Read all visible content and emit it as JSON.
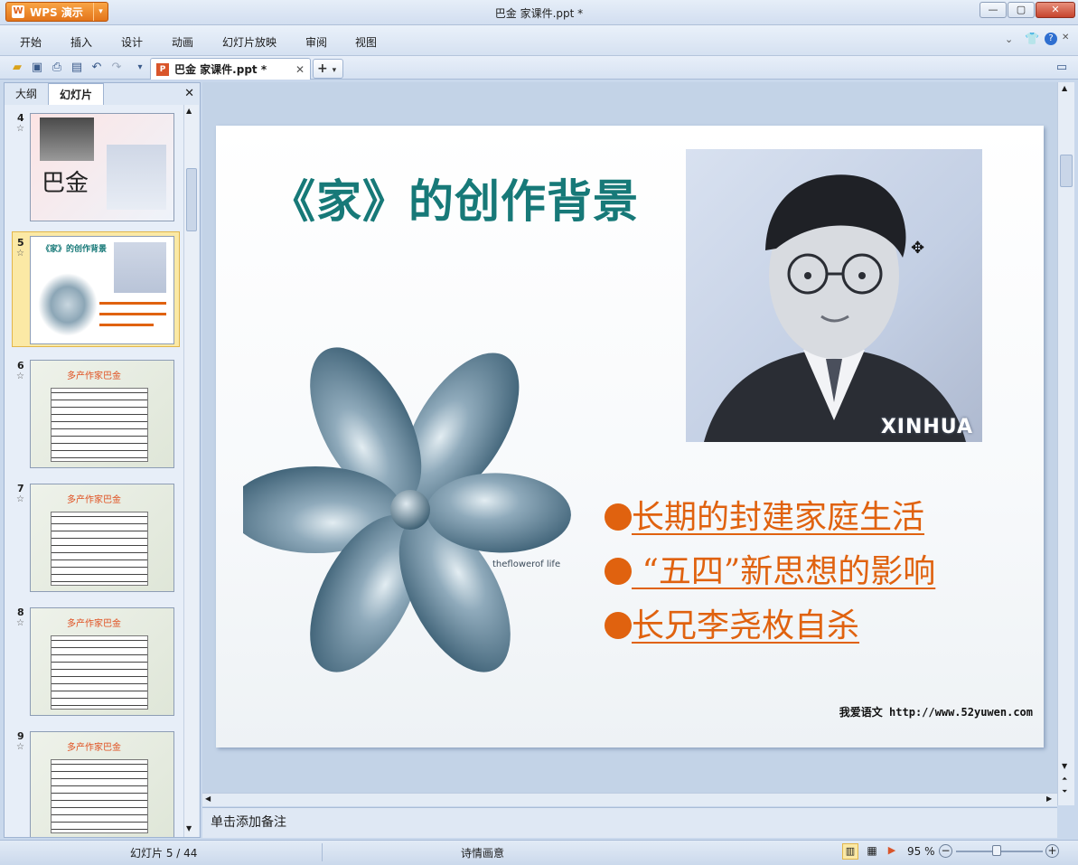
{
  "app": {
    "name": "WPS 演示",
    "window_title": "巴金  家课件.ppt *"
  },
  "menu": {
    "items": [
      "开始",
      "插入",
      "设计",
      "动画",
      "幻灯片放映",
      "审阅",
      "视图"
    ]
  },
  "doc_tab": {
    "label": "巴金  家课件.ppt *"
  },
  "left_panel": {
    "tab_outline": "大纲",
    "tab_slides": "幻灯片"
  },
  "thumbnails": [
    {
      "num": "4",
      "title": ""
    },
    {
      "num": "5",
      "title": "《家》的创作背景"
    },
    {
      "num": "6",
      "title": "多产作家巴金"
    },
    {
      "num": "7",
      "title": "多产作家巴金"
    },
    {
      "num": "8",
      "title": "多产作家巴金"
    },
    {
      "num": "9",
      "title": "多产作家巴金"
    }
  ],
  "slide": {
    "title": "《家》的创作背景",
    "portrait_caption": "XINHUA",
    "bullets": [
      "长期的封建家庭生活",
      " “五四”新思想的影响",
      "长兄李尧枚自杀"
    ],
    "flower_brand": "theflowerof life",
    "footer_name": "我爱语文",
    "footer_url": "http://www.52yuwen.com",
    "accent_color": "#e0620f",
    "title_color": "#177978"
  },
  "notes": {
    "placeholder": "单击添加备注"
  },
  "status": {
    "slide_counter": "幻灯片 5 / 44",
    "theme": "诗情画意",
    "zoom": "95 %"
  }
}
